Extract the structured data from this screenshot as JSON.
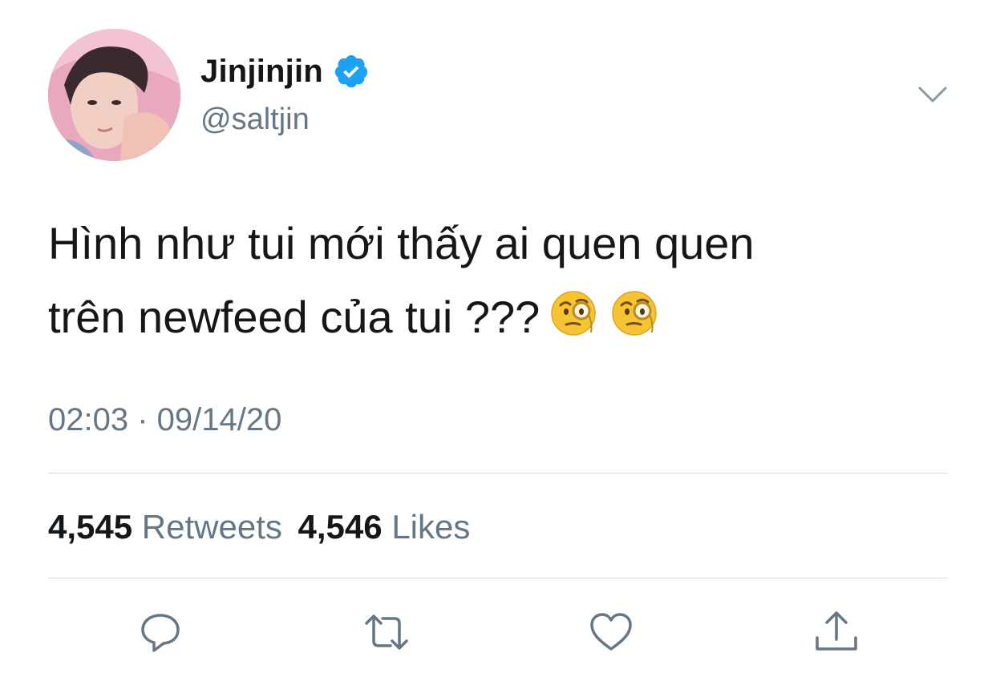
{
  "author": {
    "display_name": "Jinjinjin",
    "handle": "@saltjin",
    "verified": true,
    "avatar_icon": "profile-photo"
  },
  "tweet": {
    "line1": "Hình như tui mới thấy ai quen quen",
    "line2": "trên newfeed của tui ???",
    "emojis": [
      "face-with-monocle",
      "face-with-monocle"
    ]
  },
  "timestamp": "02:03 · 09/14/20",
  "stats": {
    "retweets_count": "4,545",
    "retweets_label": "Retweets",
    "likes_count": "4,546",
    "likes_label": "Likes"
  },
  "actions": [
    "reply-icon",
    "retweet-icon",
    "like-icon",
    "share-icon"
  ],
  "colors": {
    "text": "#14171a",
    "secondary": "#657786",
    "verified_blue": "#1da1f2",
    "divider": "#d6dbdf"
  }
}
